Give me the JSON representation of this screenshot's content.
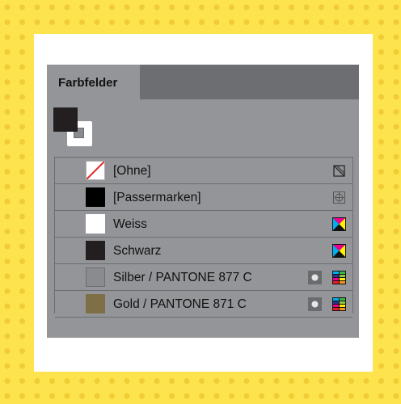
{
  "panel": {
    "tab_title": "Farbfelder"
  },
  "fill_stroke": {
    "fill_color": "#231f20",
    "stroke_color": "#ffffff"
  },
  "swatches": [
    {
      "label": "[Ohne]",
      "color": "none",
      "icons": [
        "no-edit-icon"
      ]
    },
    {
      "label": "[Passermarken]",
      "color": "#000000",
      "icons": [
        "registration-icon"
      ]
    },
    {
      "label": "Weiss",
      "color": "#ffffff",
      "icons": [
        "process-color-icon"
      ]
    },
    {
      "label": "Schwarz",
      "color": "#231f20",
      "icons": [
        "process-color-icon"
      ]
    },
    {
      "label": "Silber / PANTONE 877 C",
      "color": "#8a8b8e",
      "icons": [
        "spot-color-icon",
        "color-model-icon"
      ]
    },
    {
      "label": "Gold / PANTONE 871 C",
      "color": "#7e6f47",
      "icons": [
        "spot-color-icon",
        "color-model-icon"
      ]
    }
  ]
}
